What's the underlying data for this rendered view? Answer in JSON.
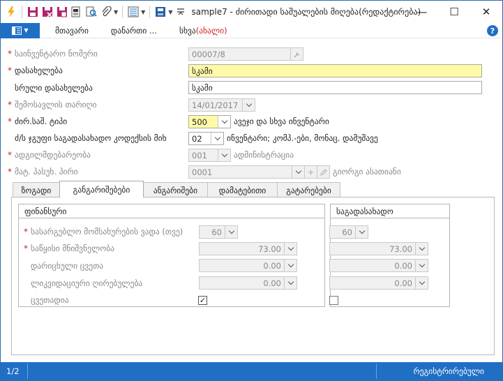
{
  "window": {
    "title": "sample7 - ძირითადი საშუალების მიღება(რედაქტირება)",
    "minimize": "—",
    "maximize": "☐",
    "close": "✕"
  },
  "toolbar": {
    "icons": [
      "lightning-icon",
      "save-icon",
      "save-close-icon",
      "save-copy-icon",
      "document-icon",
      "search-icon",
      "attach-icon",
      "list-icon",
      "print-icon",
      "title-menu-icon"
    ]
  },
  "menu": {
    "items": [
      "მთავარი",
      "დანართი ...",
      "სხვა"
    ],
    "other_suffix": "(ახალი)",
    "help": "?"
  },
  "form": {
    "inventory_number": {
      "label": "საინვენტარო ნომერი",
      "value": "00007/8"
    },
    "name": {
      "label": "დასახელება",
      "value": "სკამი"
    },
    "full_name": {
      "label": "სრული დასახელება",
      "value": "სკამი"
    },
    "entry_date": {
      "label": "შემოსავლის თარიღი",
      "value": "14/01/2017"
    },
    "asset_type": {
      "label": "ძირ.საშ. ტიპი",
      "value": "500",
      "note": "ავეჯი და სხვა ინვენტარი"
    },
    "tax_group": {
      "label": "ძ/ს ჯგუფი საგადასახადო კოდექსის მიხ",
      "value": "02",
      "note": "ინვენტარი; კომპ.-ები, მონაც. დამუშავე"
    },
    "location": {
      "label": "ადგილმდებარეობა",
      "value": "001",
      "note": "ადმინისტრაცია"
    },
    "responsible": {
      "label": "მატ. პასუხ. პირი",
      "value": "0001",
      "note": "გიორგი ასათიანი"
    }
  },
  "tabs": [
    "ზოგადი",
    "განგარიშებები",
    "ანგარიშები",
    "დამატებითი",
    "გატარებები"
  ],
  "active_tab": 1,
  "financial": {
    "title": "ფინანსური",
    "useful_life": {
      "label": "სასარგებლო მომსახურების ვადა (თვე)",
      "value": "60"
    },
    "initial_value": {
      "label": "საწყისი მნიშვნელობა",
      "value": "73.00"
    },
    "depreciation": {
      "label": "დარიცხული ცვეთა",
      "value": "0.00"
    },
    "liquidation": {
      "label": "ლიკვიდაციური ღირებულება",
      "value": "0.00"
    },
    "depreciable": {
      "label": "ცვეთადია",
      "checked": true,
      "mark": "✓"
    }
  },
  "tax": {
    "title": "საგადასახადო",
    "useful_life": "60",
    "initial_value": "73.00",
    "depreciation": "0.00",
    "liquidation": "0.00",
    "depreciable": false
  },
  "status": {
    "page": "1/2",
    "state": "რეგისტრირებული"
  }
}
